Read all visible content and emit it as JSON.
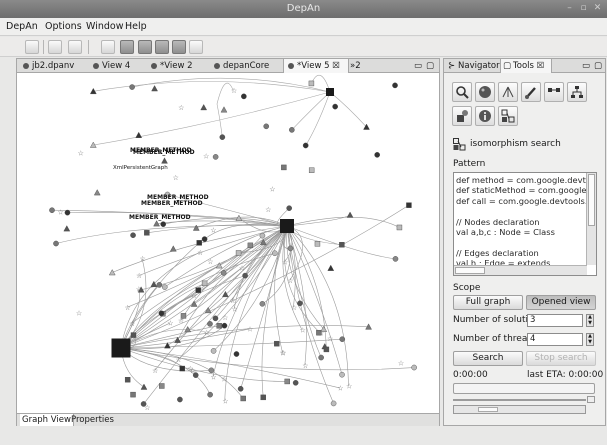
{
  "window": {
    "title": "DepAn"
  },
  "menu": [
    "DepAn",
    "Options",
    "Window",
    "Help"
  ],
  "editor_tabs": [
    {
      "label": "jb2.dpanv"
    },
    {
      "label": "View 4"
    },
    {
      "label": "*View 2"
    },
    {
      "label": "depanCore"
    },
    {
      "label": "*View 5",
      "close": "☒"
    },
    {
      "label": "»2"
    }
  ],
  "graph": {
    "labels": [
      "MEMBER_METHOD",
      "MEMBER_METHOD",
      "XmlPersistentGraph",
      "MEMBER_METHOD",
      "MEMBER_METHOD",
      "MEMBER_METHOD"
    ]
  },
  "bottom_tabs": [
    "Graph View",
    "Properties"
  ],
  "tool_tabs": [
    {
      "label": "Navigator"
    },
    {
      "label": "Tools",
      "close": "☒"
    }
  ],
  "tools": {
    "section_title": "isomorphism search",
    "pattern_label": "Pattern",
    "pattern_lines": [
      "def method = com.google.devto",
      "def staticMethod = com.google",
      "def call = com.google.devtools.",
      "",
      "// Nodes declaration",
      "val a,b,c : Node = Class",
      "",
      "// Edges declaration",
      "val h : Edge = extends"
    ],
    "scope_label": "Scope",
    "full_graph_label": "Full graph",
    "opened_view_label": "Opened view",
    "solutions_label": "Number of solutic",
    "solutions_value": "3",
    "threads_label": "Number of threac",
    "threads_value": "4",
    "search_label": "Search",
    "stop_search_label": "Stop search",
    "elapsed": "0:00:00",
    "eta": "last ETA: 0:00:00"
  }
}
